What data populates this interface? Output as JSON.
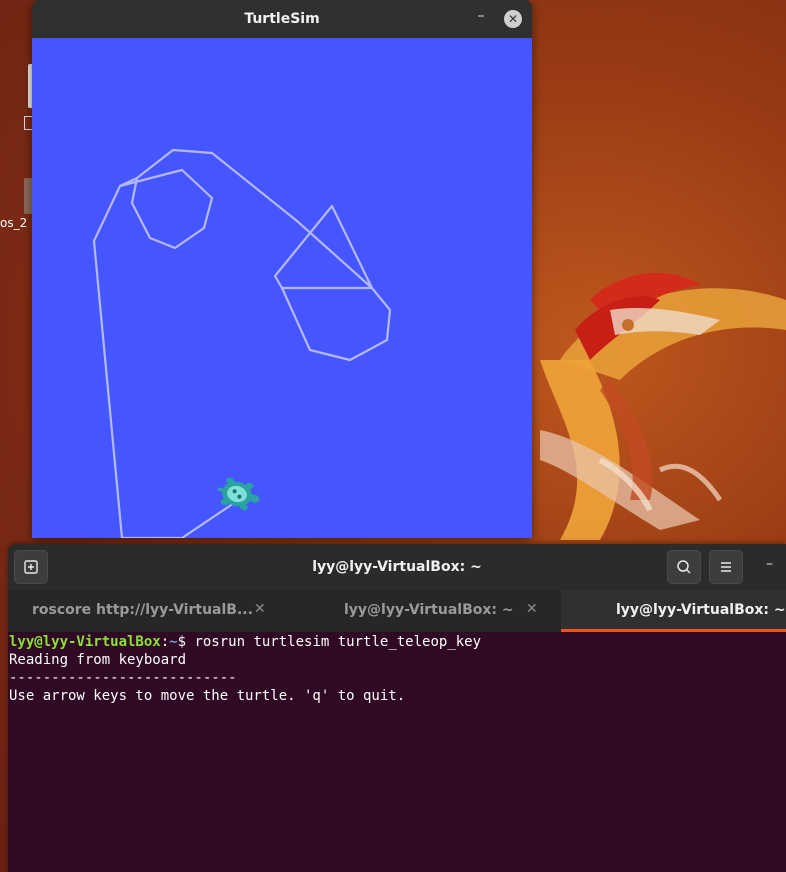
{
  "desktop": {
    "icon_label": "os_2"
  },
  "turtlesim": {
    "title": "TurtleSim",
    "minimize_glyph": "–",
    "close_glyph": "✕",
    "background_color": "#4556ff",
    "pen_color": "#b3b8ff"
  },
  "terminal": {
    "title": "lyy@lyy-VirtualBox: ~",
    "minimize_glyph": "–",
    "tabs": [
      {
        "label": "roscore http://lyy-VirtualB...",
        "active": false
      },
      {
        "label": "lyy@lyy-VirtualBox: ~",
        "active": false
      },
      {
        "label": "lyy@lyy-VirtualBox: ~",
        "active": true
      }
    ],
    "tab_close_glyph": "✕",
    "prompt_user": "lyy@lyy-VirtualBox",
    "prompt_sep": ":",
    "prompt_path": "~",
    "prompt_symbol": "$ ",
    "command": "rosrun turtlesim turtle_teleop_key",
    "output": [
      "Reading from keyboard",
      "---------------------------",
      "Use arrow keys to move the turtle. 'q' to quit."
    ],
    "accent_color": "#e95420"
  }
}
